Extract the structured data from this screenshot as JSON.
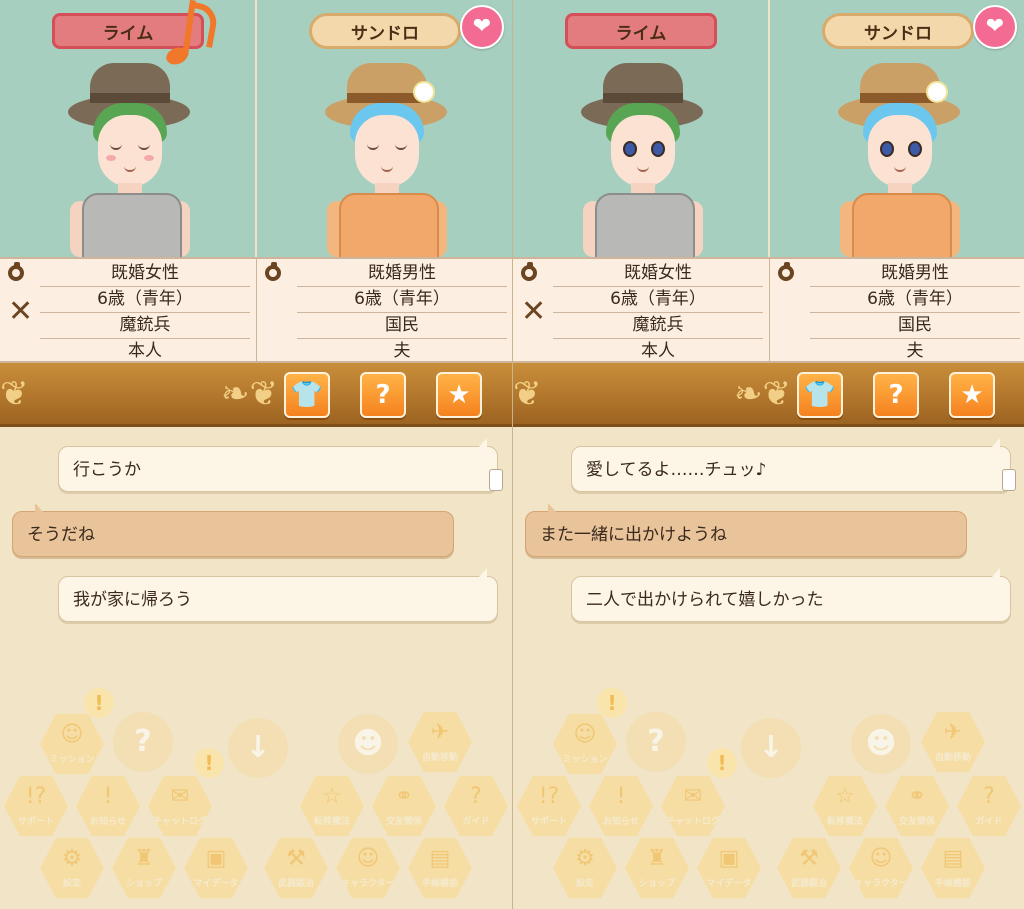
{
  "panels": [
    {
      "characters": [
        {
          "name": "ライム",
          "marital": "既婚女性",
          "age": "6歳（青年）",
          "job": "魔銃兵",
          "relation": "本人"
        },
        {
          "name": "サンドロ",
          "marital": "既婚男性",
          "age": "6歳（青年）",
          "job": "国民",
          "relation": "夫"
        }
      ],
      "messages": [
        "行こうか",
        "そうだね",
        "我が家に帰ろう"
      ]
    },
    {
      "characters": [
        {
          "name": "ライム",
          "marital": "既婚女性",
          "age": "6歳（青年）",
          "job": "魔銃兵",
          "relation": "本人"
        },
        {
          "name": "サンドロ",
          "marital": "既婚男性",
          "age": "6歳（青年）",
          "job": "国民",
          "relation": "夫"
        }
      ],
      "messages": [
        "愛してるよ……チュッ♪",
        "また一緒に出かけようね",
        "二人で出かけられて嬉しかった"
      ]
    }
  ],
  "toolbar": {
    "outfit_icon": "shirt-icon",
    "help_icon": "question-icon",
    "favorite_icon": "star-icon",
    "help_glyph": "?",
    "favorite_glyph": "★"
  },
  "menu": {
    "row1": [
      "ミッション",
      "",
      "",
      "",
      "",
      "自動移動"
    ],
    "row2": [
      "サポート",
      "お知らせ",
      "チャットログ",
      "転移魔法",
      "交友関係",
      "ガイド"
    ],
    "row3": [
      "設定",
      "ショップ",
      "マイデータ",
      "武器鍛冶",
      "キャラクター",
      "手帳機能"
    ]
  },
  "colors": {
    "accent": "#f5821f",
    "heart": "#f36a93",
    "female_tag": "#e37c7f",
    "male_tag": "#f3d8ac"
  }
}
